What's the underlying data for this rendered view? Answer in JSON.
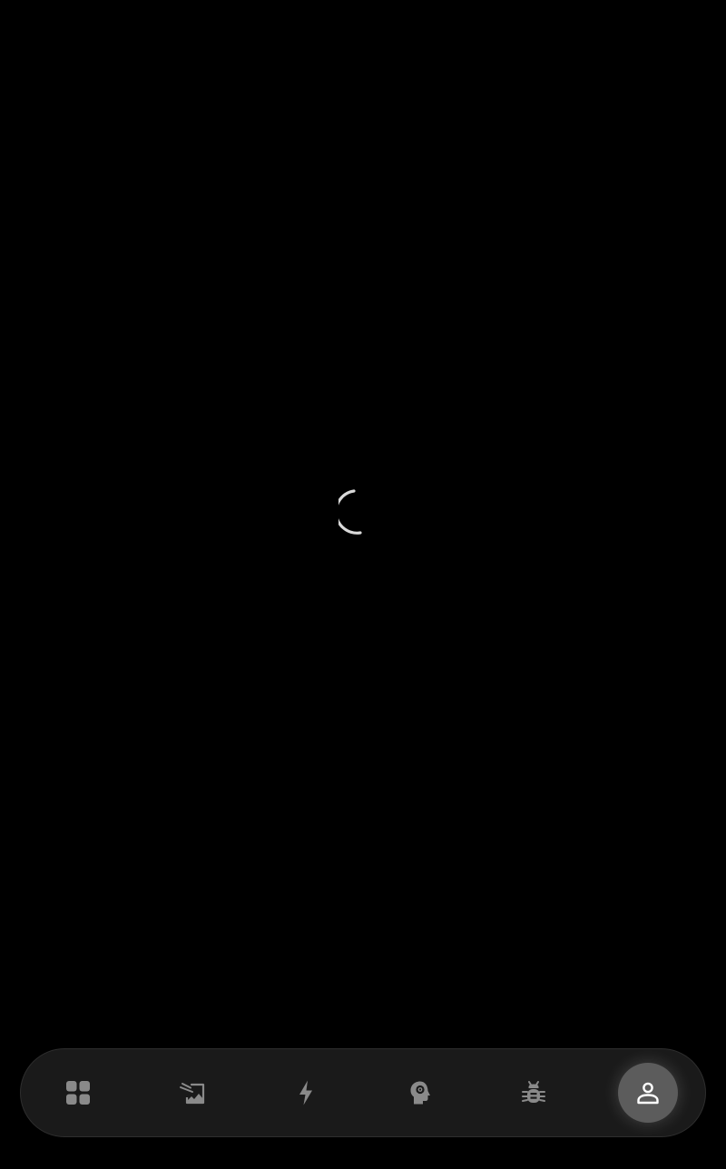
{
  "screen": {
    "state": "loading"
  },
  "loader": {
    "icon": "loading-spinner-icon",
    "color": "#d9d9d9"
  },
  "bottom_nav": {
    "active_index": 5,
    "icon_color": "#8a8a8a",
    "active_icon_color": "#ffffff",
    "items": [
      {
        "key": "dashboard",
        "icon": "grid-icon"
      },
      {
        "key": "image-edit",
        "icon": "image-edit-icon"
      },
      {
        "key": "quick-actions",
        "icon": "lightning-icon"
      },
      {
        "key": "mind-settings",
        "icon": "head-gear-icon"
      },
      {
        "key": "debug",
        "icon": "bug-icon"
      },
      {
        "key": "profile",
        "icon": "person-icon"
      }
    ]
  }
}
